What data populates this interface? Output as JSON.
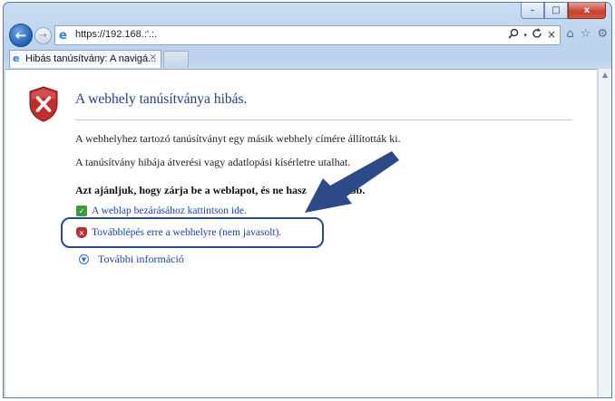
{
  "window": {
    "minimize": "–",
    "restore": "□",
    "close": "x"
  },
  "nav": {
    "back": "←",
    "forward": "→",
    "url": "https://192.168.:'.:.",
    "search_icon": "search-icon",
    "refresh_icon": "refresh-icon",
    "stop": "×",
    "home": "⌂",
    "favorites": "☆",
    "tools": "⚙"
  },
  "tab": {
    "title": "Hibás tanúsítvány: A navigá...",
    "close": "×"
  },
  "page": {
    "title": "A webhely tanúsítványa hibás.",
    "para1": "A webhelyhez tartozó tanúsítványt egy másik webhely címére állították ki.",
    "para2": "A tanúsítvány hibája átverési vagy adatlopási kísérletre utalhat.",
    "recommendation": "Azt ajánljuk, hogy zárja be a weblapot, és ne hasz              abb.",
    "close_link": "A weblap bezárásához kattintson ide.",
    "continue_link": "Továbblépés erre a webhelyre (nem javasolt).",
    "more_info": "További információ"
  },
  "colors": {
    "title_blue": "#1f3f86",
    "link_blue": "#1a44b8",
    "annotation_navy": "#2d4a88",
    "shield_red": "#c42b2b"
  }
}
